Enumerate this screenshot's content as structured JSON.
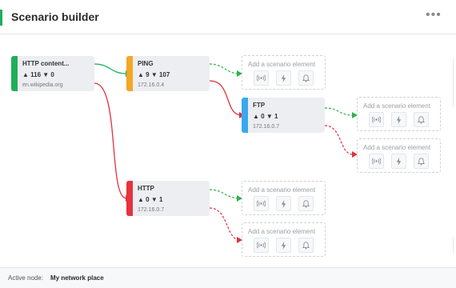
{
  "header": {
    "title": "Scenario builder",
    "menu_label": "•••"
  },
  "colors": {
    "accent": "#1fae5b",
    "node_green": "#1fae5b",
    "node_orange": "#f5a623",
    "node_blue": "#3aa8ef",
    "node_red": "#e8323c",
    "link_green": "#1fae5b",
    "link_red": "#e0313a",
    "link_green_dashed": "#2fb34a",
    "link_red_dashed": "#e0313a"
  },
  "nodes": {
    "http_content": {
      "title": "HTTP content...",
      "stats": "▲ 116 ▼ 0",
      "ip": "en.wikipedia.org"
    },
    "ping": {
      "title": "PING",
      "stats": "▲ 9 ▼ 107",
      "ip": "172.16.0.4"
    },
    "ftp": {
      "title": "FTP",
      "stats": "▲ 0 ▼ 1",
      "ip": "172.16.0.7"
    },
    "http": {
      "title": "HTTP",
      "stats": "▲ 0 ▼ 1",
      "ip": "172.16.0.7"
    }
  },
  "add_element": {
    "label": "Add a scenario element",
    "icons": [
      "radio-waves-icon",
      "bolt-icon",
      "bell-icon"
    ]
  },
  "footer": {
    "label": "Active node:",
    "value": "My network place"
  }
}
